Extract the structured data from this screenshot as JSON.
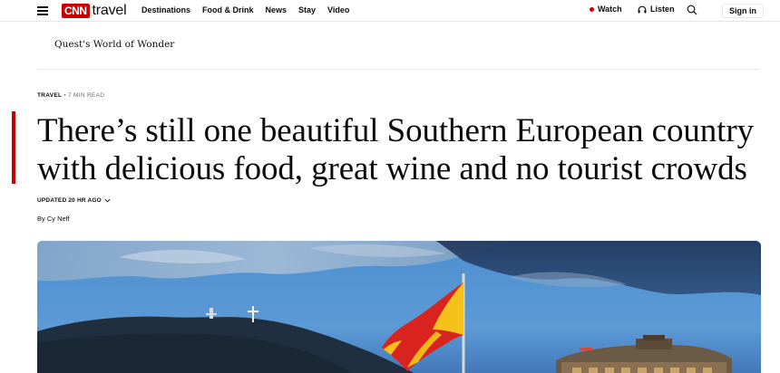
{
  "nav": {
    "brand_box": "CNN",
    "brand_word": "travel",
    "links": [
      "Destinations",
      "Food & Drink",
      "News",
      "Stay",
      "Video"
    ],
    "watch_label": "Watch",
    "listen_label": "Listen",
    "signin_label": "Sign in"
  },
  "subnav": {
    "title": "Quest's World of Wonder"
  },
  "article": {
    "section": "TRAVEL",
    "separator": "•",
    "read_time": "7 MIN READ",
    "headline": "There’s still one beautiful Southern European country with delicious food, great wine and no tourist crowds",
    "updated": "UPDATED 20 HR AGO",
    "byline": "By Cy Neff"
  },
  "icons": {
    "menu": "hamburger-menu-icon",
    "watch": "live-dot-icon",
    "listen": "headphones-icon",
    "search": "search-icon",
    "updated": "chevron-down-icon"
  },
  "colors": {
    "brand_red": "#cc0000",
    "text": "#0c0c0c",
    "muted": "#6e6e6e",
    "divider": "#e6e6e6"
  }
}
